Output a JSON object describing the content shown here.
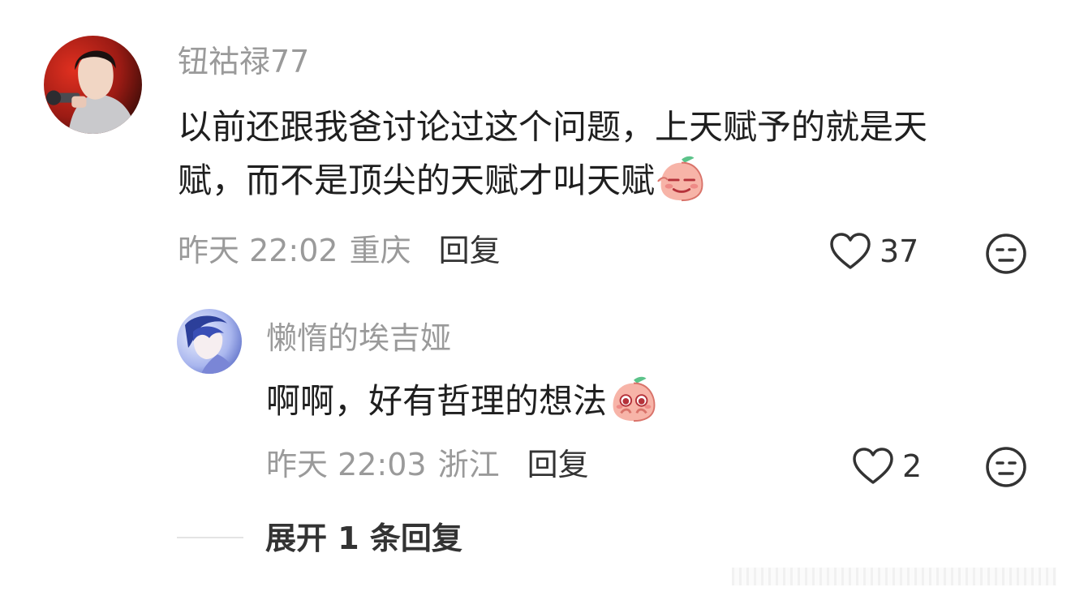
{
  "comments": [
    {
      "username": "钮祜禄77",
      "text_line1": "以前还跟我爸讨论过这个问题，上天赋予的就是天",
      "text_line2": "赋，而不是顶尖的天赋才叫天赋",
      "emoji": "smirk-peach-emoji",
      "time": "昨天 22:02",
      "location": "重庆",
      "reply_label": "回复",
      "likes": "37"
    },
    {
      "username": "懒惰的埃吉娅",
      "text": "啊啊，好有哲理的想法",
      "emoji": "pleading-peach-emoji",
      "time": "昨天 22:03",
      "location": "浙江",
      "reply_label": "回复",
      "likes": "2"
    }
  ],
  "expand_replies": "展开 1 条回复",
  "icons": {
    "like": "heart-outline-icon",
    "dislike": "meh-face-icon"
  },
  "colors": {
    "username": "#9a9a9a",
    "meta": "#9a9a9a",
    "text": "#1f1f1f",
    "action": "#333333",
    "divider": "#e4e4e4"
  }
}
